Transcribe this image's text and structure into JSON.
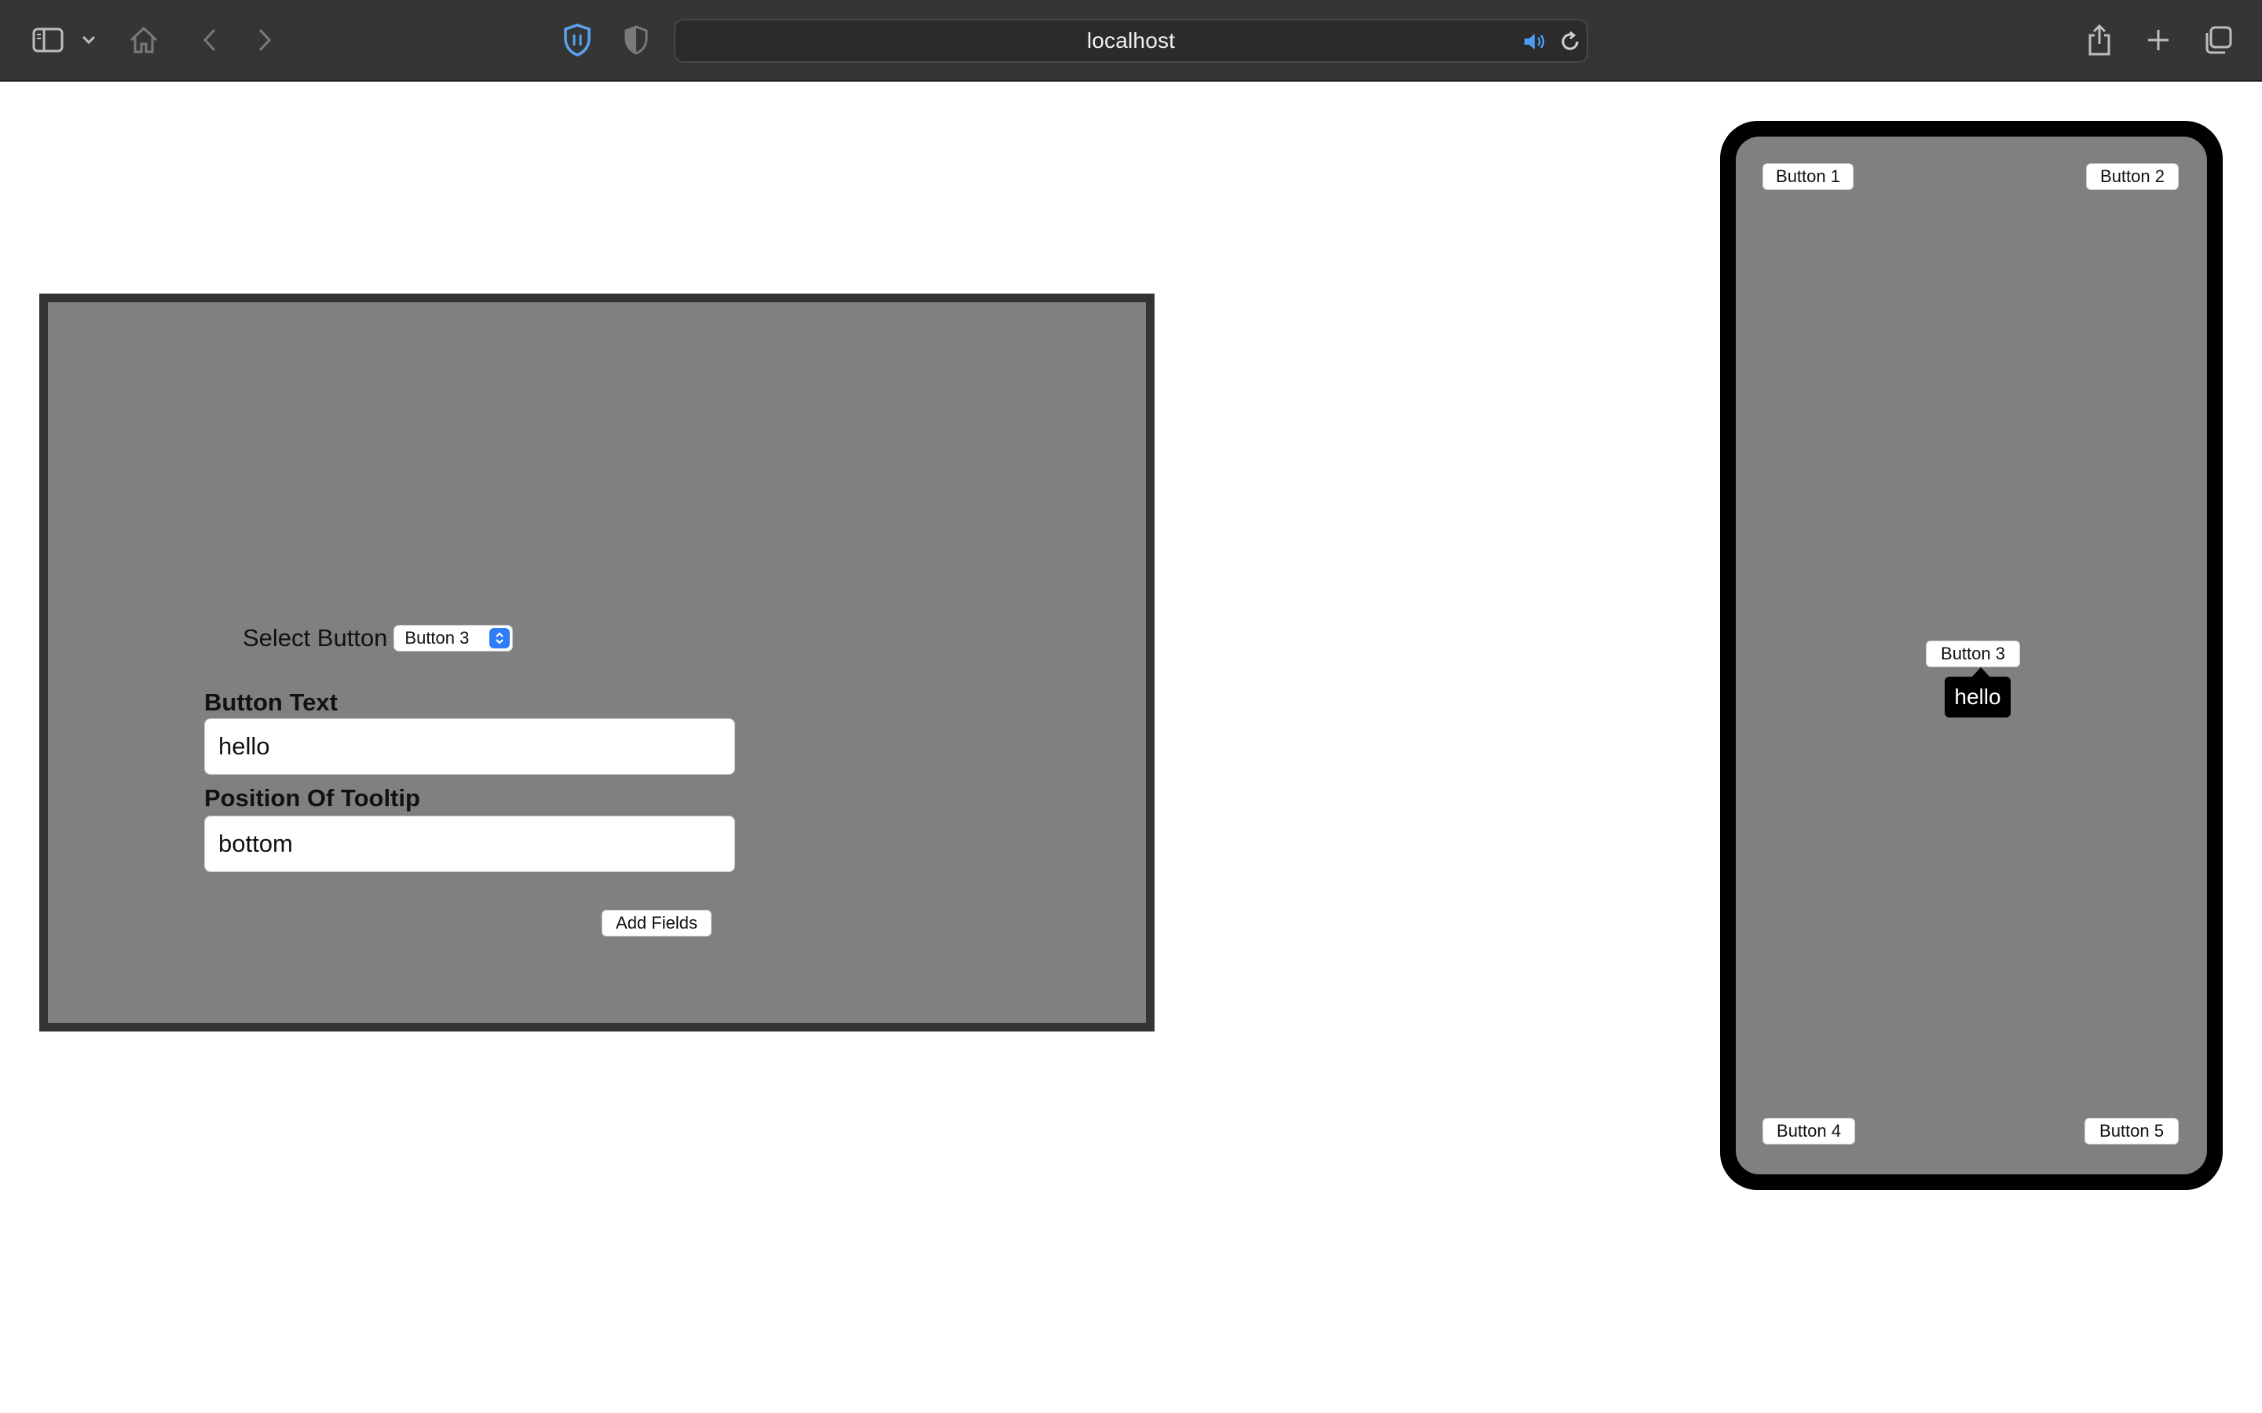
{
  "browser": {
    "address": "localhost"
  },
  "editor": {
    "select_label": "Select Button",
    "select_value": "Button 3",
    "button_text_label": "Button Text",
    "button_text_value": "hello",
    "position_label": "Position Of Tooltip",
    "position_value": "bottom",
    "add_fields_label": "Add Fields"
  },
  "preview": {
    "buttons": [
      "Button 1",
      "Button 2",
      "Button 3",
      "Button 4",
      "Button 5"
    ],
    "tooltip_text": "hello"
  },
  "colors": {
    "toolbar": "#353535",
    "panel_bg": "#808080",
    "panel_border": "#333333",
    "accent": "#2f7cf6"
  }
}
